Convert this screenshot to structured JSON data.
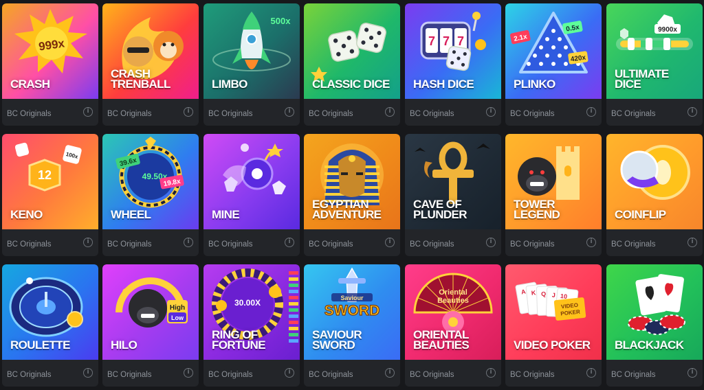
{
  "provider_label": "BC Originals",
  "info_glyph": "i",
  "games": [
    {
      "title": "CRASH",
      "art": "crash",
      "bg": [
        "#f5a623",
        "#ff4fa6",
        "#7b3cf0"
      ],
      "badges": [
        "999x"
      ]
    },
    {
      "title": "CRASH\nTRENBALL",
      "art": "trenball",
      "bg": [
        "#ffb31a",
        "#ff3d3d",
        "#f01e8c"
      ],
      "badges": []
    },
    {
      "title": "LIMBO",
      "art": "limbo",
      "bg": [
        "#1f9c7a",
        "#1b6f6a",
        "#2b3a50"
      ],
      "badges": [
        "500x"
      ]
    },
    {
      "title": "CLASSIC DICE",
      "art": "classicdice",
      "bg": [
        "#7ad33a",
        "#1fb86a",
        "#13a08a"
      ],
      "badges": []
    },
    {
      "title": "HASH DICE",
      "art": "hashdice",
      "bg": [
        "#7b3cf0",
        "#3a6cf5",
        "#19b6d6"
      ],
      "badges": []
    },
    {
      "title": "PLINKO",
      "art": "plinko",
      "bg": [
        "#2dd4e6",
        "#3a6cf5",
        "#7b3cf0"
      ],
      "badges": [
        "2.1x",
        "0.5x",
        "420x"
      ]
    },
    {
      "title": "ULTIMATE\nDICE",
      "art": "ultimatedice",
      "bg": [
        "#49d65a",
        "#20b86e",
        "#18a77a"
      ],
      "badges": [
        "9900x"
      ]
    },
    {
      "title": "KENO",
      "art": "keno",
      "bg": [
        "#ff4d6d",
        "#ff7a3d",
        "#ffae2b"
      ],
      "badges": [
        "12",
        "100x"
      ]
    },
    {
      "title": "WHEEL",
      "art": "wheel",
      "bg": [
        "#2cc7b4",
        "#2f7df0",
        "#6a3cf0"
      ],
      "badges": [
        "39.6x",
        "49.50x",
        "19.8x"
      ]
    },
    {
      "title": "MINE",
      "art": "mine",
      "bg": [
        "#d04bf5",
        "#8a3cf0",
        "#5a2ae0"
      ],
      "badges": []
    },
    {
      "title": "EGYPTIAN\nADVENTURE",
      "art": "egyptian",
      "bg": [
        "#f4a51e",
        "#f08a1a",
        "#e8741a"
      ],
      "badges": []
    },
    {
      "title": "CAVE OF\nPLUNDER",
      "art": "cave",
      "bg": [
        "#2a3744",
        "#1f2a35",
        "#17212b"
      ],
      "badges": []
    },
    {
      "title": "TOWER\nLEGEND",
      "art": "tower",
      "bg": [
        "#ffb72b",
        "#ff9a2b",
        "#ff7e2b"
      ],
      "badges": []
    },
    {
      "title": "COINFLIP",
      "art": "coinflip",
      "bg": [
        "#ffb52b",
        "#ff9a2b",
        "#f7862b"
      ],
      "badges": []
    },
    {
      "title": "ROULETTE",
      "art": "roulette",
      "bg": [
        "#16a7e0",
        "#2a74f0",
        "#4a3cf0"
      ],
      "badges": []
    },
    {
      "title": "HILO",
      "art": "hilo",
      "bg": [
        "#e040fb",
        "#a53cf0",
        "#7b3cf0"
      ],
      "badges": [
        "High",
        "Low"
      ]
    },
    {
      "title": "RING OF\nFORTUNE",
      "art": "ring",
      "bg": [
        "#b63cf0",
        "#8a2ae0",
        "#6a1fd0"
      ],
      "badges": [
        "30.00X"
      ]
    },
    {
      "title": "SAVIOUR\nSWORD",
      "art": "sword",
      "bg": [
        "#35c6f0",
        "#2f8df0",
        "#3a6cf5"
      ],
      "badges": [
        "Saviour",
        "SWORD"
      ]
    },
    {
      "title": "ORIENTAL\nBEAUTIES",
      "art": "oriental",
      "bg": [
        "#ff3d8a",
        "#f02a6e",
        "#d81e5a"
      ],
      "badges": [
        "Oriental",
        "Beauties"
      ]
    },
    {
      "title": "VIDEO POKER",
      "art": "videopoker",
      "bg": [
        "#ff5a6e",
        "#ff3d5a",
        "#f0304a"
      ],
      "badges": [
        "VIDEO",
        "POKER"
      ]
    },
    {
      "title": "BLACKJACK",
      "art": "blackjack",
      "bg": [
        "#3fd64a",
        "#22c05a",
        "#17a85a"
      ],
      "badges": []
    }
  ]
}
